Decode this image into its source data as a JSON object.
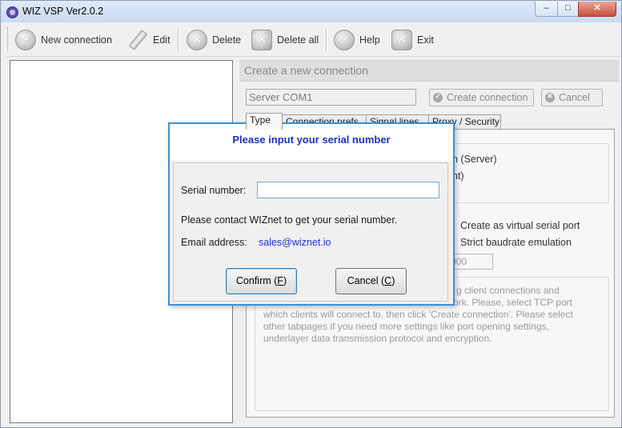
{
  "window": {
    "title": "WIZ VSP Ver2.0.2",
    "min_label": "–",
    "max_label": "□",
    "close_label": "✕"
  },
  "toolbar": {
    "new_connection": "New connection",
    "edit": "Edit",
    "delete": "Delete",
    "delete_all": "Delete all",
    "help": "Help",
    "exit": "Exit"
  },
  "right_panel": {
    "header": "Create a new connection",
    "connection_name": "Server COM1",
    "create_button": "Create connection",
    "cancel_button": "Cancel",
    "tabs": [
      "Type",
      "Connection prefs",
      "Signal lines",
      "Proxy / Security"
    ],
    "partial_options": [
      "n (Server)",
      "nt)"
    ],
    "checkbox_virtual": "Create as virtual serial port",
    "checkbox_strict": "Strict baudrate emulation",
    "port_value": "000",
    "description_partial_1": "g client connections and",
    "description_partial_2": "ork. Please, select TCP port",
    "description_lines": [
      "which clients will connect to, then click 'Create connection'. Please select",
      "other tabpages if you need more settings like port opening settings,",
      "underlayer data transmission protocol and encryption."
    ]
  },
  "dialog": {
    "title": "Please input your serial number",
    "serial_label": "Serial number:",
    "serial_value": "",
    "contact_text": "Please contact WIZnet to get your serial number.",
    "email_label": "Email address:",
    "email_value": "sales@wiznet.io",
    "confirm_label": "Confirm (",
    "confirm_key": "F",
    "cancel_label": "Cancel (",
    "cancel_key": "C",
    "close_paren": ")"
  },
  "colors": {
    "dialog_border": "#3e8fd8",
    "dialog_title": "#1a2fbf",
    "link": "#1a2fd8"
  }
}
